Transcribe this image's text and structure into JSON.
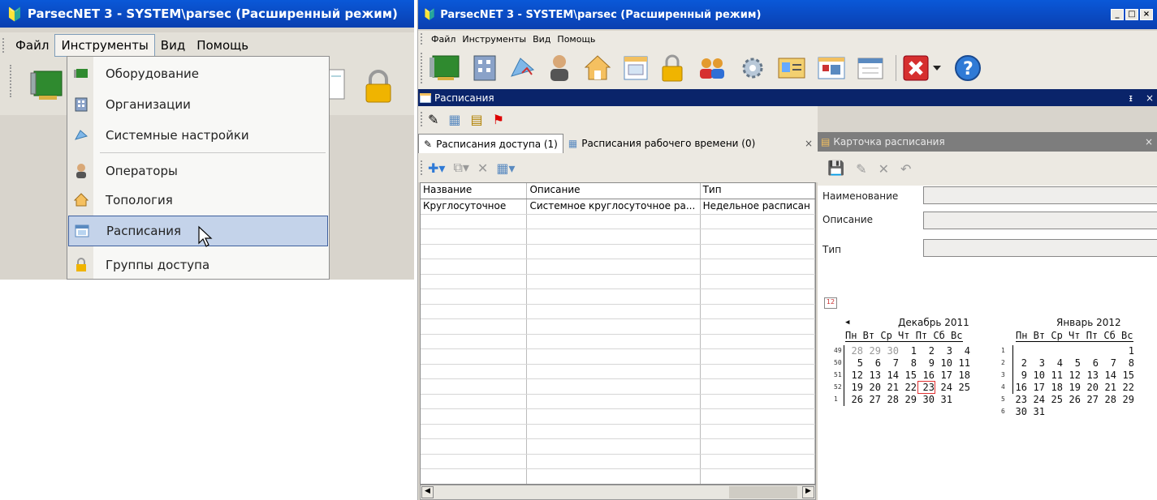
{
  "left": {
    "title": "ParsecNET 3 - SYSTEM\\parsec (Расширенный режим)",
    "menubar": [
      "Файл",
      "Инструменты",
      "Вид",
      "Помощь"
    ],
    "menu_items": [
      {
        "label": "Оборудование",
        "icon": "hardware-icon"
      },
      {
        "label": "Организации",
        "icon": "organization-icon"
      },
      {
        "label": "Системные настройки",
        "icon": "settings-icon"
      },
      {
        "label": "Операторы",
        "icon": "operator-icon"
      },
      {
        "label": "Топология",
        "icon": "topology-icon"
      },
      {
        "label": "Расписания",
        "icon": "schedule-icon"
      },
      {
        "label": "Группы доступа",
        "icon": "lock-icon"
      }
    ]
  },
  "right": {
    "title": "ParsecNET 3 - SYSTEM\\parsec (Расширенный режим)",
    "menubar": [
      "Файл",
      "Инструменты",
      "Вид",
      "Помощь"
    ],
    "doc_title": "Расписания",
    "tabs": [
      "Расписания доступа (1)",
      "Расписания рабочего времени (0)"
    ],
    "columns": [
      "Название",
      "Описание",
      "Тип"
    ],
    "rows": [
      [
        "Круглосуточное",
        "Системное круглосуточное ра...",
        "Недельное расписан"
      ]
    ],
    "card": {
      "title": "Карточка расписания",
      "fields": [
        "Наименование",
        "Описание",
        "Тип"
      ]
    },
    "calendar": {
      "months": [
        "Декабрь 2011",
        "Январь 2012"
      ],
      "dow": "Пн Вт Ср Чт Пт Сб Вс",
      "dec_weeks": [
        "49",
        "50",
        "51",
        "52",
        "1"
      ],
      "dec_rows": [
        [
          "28",
          "29",
          "30",
          "1",
          "2",
          "3",
          "4"
        ],
        [
          "5",
          "6",
          "7",
          "8",
          "9",
          "10",
          "11"
        ],
        [
          "12",
          "13",
          "14",
          "15",
          "16",
          "17",
          "18"
        ],
        [
          "19",
          "20",
          "21",
          "22",
          "23",
          "24",
          "25"
        ],
        [
          "26",
          "27",
          "28",
          "29",
          "30",
          "31",
          ""
        ]
      ],
      "jan_weeks": [
        "1",
        "2",
        "3",
        "4",
        "5",
        "6"
      ],
      "jan_rows": [
        "                  1",
        "2  3  4  5  6  7  8",
        "9 10 11 12 13 14 15",
        "16 17 18 19 20 21 22",
        "23 24 25 26 27 28 29",
        "30 31"
      ]
    }
  }
}
